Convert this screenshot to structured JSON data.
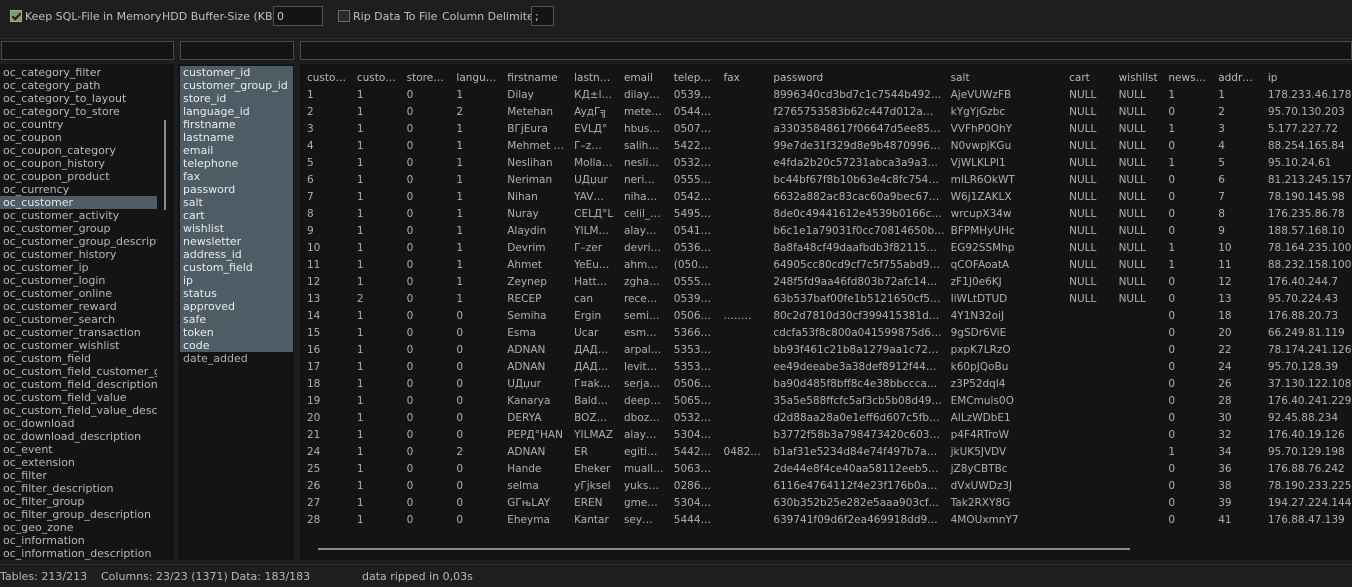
{
  "toolbar": {
    "keep_sql": {
      "label": "Keep SQL-File in Memory",
      "checked": true
    },
    "hdd_buffer": {
      "label": "HDD Buffer-Size (KB):",
      "value": "0"
    },
    "rip_data": {
      "label": "Rip Data To File",
      "checked": false
    },
    "column_delimiter": {
      "label": "Column Delimiter :",
      "value": ";"
    }
  },
  "tables": [
    "oc_category_filter",
    "oc_category_path",
    "oc_category_to_layout",
    "oc_category_to_store",
    "oc_country",
    "oc_coupon",
    "oc_coupon_category",
    "oc_coupon_history",
    "oc_coupon_product",
    "oc_currency",
    "oc_customer",
    "oc_customer_activity",
    "oc_customer_group",
    "oc_customer_group_description",
    "oc_customer_history",
    "oc_customer_ip",
    "oc_customer_login",
    "oc_customer_online",
    "oc_customer_reward",
    "oc_customer_search",
    "oc_customer_transaction",
    "oc_customer_wishlist",
    "oc_custom_field",
    "oc_custom_field_customer_grou",
    "oc_custom_field_description",
    "oc_custom_field_value",
    "oc_custom_field_value_descript",
    "oc_download",
    "oc_download_description",
    "oc_event",
    "oc_extension",
    "oc_filter",
    "oc_filter_description",
    "oc_filter_group",
    "oc_filter_group_description",
    "oc_geo_zone",
    "oc_information",
    "oc_information_description"
  ],
  "selected_table": "oc_customer",
  "columns": [
    {
      "name": "customer_id",
      "selected": true
    },
    {
      "name": "customer_group_id",
      "selected": true
    },
    {
      "name": "store_id",
      "selected": true
    },
    {
      "name": "language_id",
      "selected": true
    },
    {
      "name": "firstname",
      "selected": true
    },
    {
      "name": "lastname",
      "selected": true
    },
    {
      "name": "email",
      "selected": true
    },
    {
      "name": "telephone",
      "selected": true
    },
    {
      "name": "fax",
      "selected": true
    },
    {
      "name": "password",
      "selected": true
    },
    {
      "name": "salt",
      "selected": true
    },
    {
      "name": "cart",
      "selected": true
    },
    {
      "name": "wishlist",
      "selected": true
    },
    {
      "name": "newsletter",
      "selected": true
    },
    {
      "name": "address_id",
      "selected": true
    },
    {
      "name": "custom_field",
      "selected": true
    },
    {
      "name": "ip",
      "selected": true
    },
    {
      "name": "status",
      "selected": true
    },
    {
      "name": "approved",
      "selected": true
    },
    {
      "name": "safe",
      "selected": true
    },
    {
      "name": "token",
      "selected": true
    },
    {
      "name": "code",
      "selected": true
    },
    {
      "name": "date_added",
      "selected": false
    }
  ],
  "grid_headers": [
    "custo…",
    "custo…",
    "store…",
    "langu…",
    "firstname",
    "lastn…",
    "email",
    "telep…",
    "fax",
    "password",
    "salt",
    "cart",
    "wishlist",
    "news…",
    "addr…",
    "ip"
  ],
  "grid_rows": [
    [
      "1",
      "1",
      "0",
      "1",
      "Dilay",
      "КД±l…",
      "dilay…",
      "0539…",
      "",
      "8996340cd3bd7c1c7544b492…",
      "AjeVUWzFB",
      "NULL",
      "NULL",
      "1",
      "1",
      "178.233.46.178"
    ],
    [
      "2",
      "1",
      "0",
      "2",
      "Metehan",
      "AyдГ╗",
      "mete…",
      "0544…",
      "",
      "f2765753583b62c447d012a…",
      "kYgYjGzbc",
      "NULL",
      "NULL",
      "0",
      "2",
      "95.70.130.203"
    ],
    [
      "3",
      "1",
      "0",
      "1",
      "ВГјEura",
      "EVLД°",
      "hbus…",
      "0507…",
      "",
      "a33035848617f06647d5ee85…",
      "VVFhP0OhY",
      "NULL",
      "NULL",
      "1",
      "3",
      "5.177.227.72"
    ],
    [
      "4",
      "1",
      "0",
      "1",
      "Mehmet …",
      "Г–z…",
      "salih…",
      "5422…",
      "",
      "99e7de31f329d8e9b4870996…",
      "N0vwpjKGu",
      "NULL",
      "NULL",
      "0",
      "4",
      "88.254.165.84"
    ],
    [
      "5",
      "1",
      "0",
      "1",
      "Neslihan",
      "Molla…",
      "nesli…",
      "0532…",
      "",
      "e4fda2b20c57231abca3a9a3…",
      "VjWLKLPl1",
      "NULL",
      "NULL",
      "1",
      "5",
      "95.10.24.61"
    ],
    [
      "6",
      "1",
      "0",
      "1",
      "Neriman",
      "UДџur",
      "neri…",
      "0555…",
      "",
      "bc44bf67f8b10b63e4c8fc754…",
      "mlLR6OkWT",
      "NULL",
      "NULL",
      "0",
      "6",
      "81.213.245.157"
    ],
    [
      "7",
      "1",
      "0",
      "1",
      "Nihan",
      "YAV…",
      "niha…",
      "0542…",
      "",
      "6632a882ac83cac60a9bec67…",
      "W6j1ZAKLX",
      "NULL",
      "NULL",
      "0",
      "7",
      "78.190.145.98"
    ],
    [
      "8",
      "1",
      "0",
      "1",
      "Nuray",
      "CELД°L",
      "celil_…",
      "5495…",
      "",
      "8de0c49441612e4539b0166c…",
      "wrcupX34w",
      "NULL",
      "NULL",
      "0",
      "8",
      "176.235.86.78"
    ],
    [
      "9",
      "1",
      "0",
      "1",
      "Alaydin",
      "YILM…",
      "alay…",
      "0541…",
      "",
      "b6c1e1a79031f0cc70814650b…",
      "BFPMHyUHc",
      "NULL",
      "NULL",
      "0",
      "9",
      "188.57.168.10"
    ],
    [
      "10",
      "1",
      "0",
      "1",
      "Devrim",
      "Г–zer",
      "devri…",
      "0536…",
      "",
      "8a8fa48cf49daafbdb3f82115…",
      "EG92SSMhp",
      "NULL",
      "NULL",
      "1",
      "10",
      "78.164.235.100"
    ],
    [
      "11",
      "1",
      "0",
      "1",
      "Ahmet",
      "YeEu…",
      "ahm…",
      "(050…",
      "",
      "64905cc80cd9cf7c5f755abd9…",
      "qCOFAoatA",
      "NULL",
      "NULL",
      "1",
      "11",
      "88.232.158.100"
    ],
    [
      "12",
      "1",
      "0",
      "1",
      "Zeynep",
      "Hatt…",
      "zgha…",
      "0555…",
      "",
      "248f5fd9aa46fd803b72afc14…",
      "zF1J0e6KJ",
      "NULL",
      "NULL",
      "0",
      "12",
      "176.40.244.7"
    ],
    [
      "13",
      "2",
      "0",
      "1",
      "RECEP",
      "can",
      "rece…",
      "0539…",
      "",
      "63b537baf00fe1b5121650cf5…",
      "IiWLtDTUD",
      "NULL",
      "NULL",
      "0",
      "13",
      "95.70.224.43"
    ],
    [
      "14",
      "1",
      "0",
      "0",
      "Semiha",
      "Ergin",
      "semi…",
      "0506…",
      "……..",
      "80c2d7810d30cf399415381d…",
      "4Y1N32oiJ",
      "",
      "",
      "0",
      "0",
      "18",
      "176.88.20.73"
    ],
    [
      "15",
      "1",
      "0",
      "0",
      "Esma",
      "Ucar",
      "esm…",
      "5366…",
      "",
      "cdcfa53f8c800a041599875d6…",
      "9gSDr6ViE",
      "",
      "",
      "0",
      "0",
      "20",
      "66.249.81.119"
    ],
    [
      "16",
      "1",
      "0",
      "0",
      "ADNAN",
      "ДАД…",
      "arpal…",
      "5353…",
      "",
      "bb93f461c21b8a1279aa1c72…",
      "pxpK7LRzO",
      "",
      "",
      "0",
      "0",
      "22",
      "78.174.241.126"
    ],
    [
      "17",
      "1",
      "0",
      "0",
      "ADNAN",
      "ДАД…",
      "levit…",
      "5353…",
      "",
      "ee49deeabe3a38def8912f44…",
      "k60pJQoBu",
      "",
      "",
      "0",
      "0",
      "24",
      "95.70.128.39"
    ],
    [
      "18",
      "1",
      "0",
      "0",
      "UДџur",
      "Г¤ak…",
      "serja…",
      "0506…",
      "",
      "ba90d485f8bff8c4e38bbccca…",
      "z3P52dql4",
      "",
      "",
      "0",
      "0",
      "26",
      "37.130.122.108"
    ],
    [
      "19",
      "1",
      "0",
      "0",
      "Kanarya",
      "Bald…",
      "deep…",
      "5065…",
      "",
      "35a5e588ffcfc5af3cb5b08d49…",
      "EMCmuls0O",
      "",
      "",
      "0",
      "0",
      "28",
      "176.40.241.229"
    ],
    [
      "20",
      "1",
      "0",
      "0",
      "DERYA",
      "BOZ…",
      "dboz…",
      "0532…",
      "",
      "d2d88aa28a0e1eff6d607c5fb…",
      "AILzWDbE1",
      "",
      "",
      "0",
      "0",
      "30",
      "92.45.88.234"
    ],
    [
      "21",
      "1",
      "0",
      "0",
      "РЕРД°HAN",
      "YILMAZ",
      "alay…",
      "5304…",
      "",
      "b3772f58b3a798473420c603…",
      "p4F4RTroW",
      "",
      "",
      "0",
      "0",
      "32",
      "176.40.19.126"
    ],
    [
      "24",
      "1",
      "0",
      "2",
      "ADNAN",
      "ER",
      "egiti…",
      "5442…",
      "0482…",
      "b1af31e5234d84e74f497b7a…",
      "jkUK5JVDV",
      "",
      "",
      "0",
      "1",
      "34",
      "95.70.129.198"
    ],
    [
      "25",
      "1",
      "0",
      "0",
      "Hande",
      "Eheker",
      "muall…",
      "5063…",
      "",
      "2de44e8f4ce40aa58112eeb5…",
      "jZ8yCBTBc",
      "",
      "",
      "0",
      "0",
      "36",
      "176.88.76.242"
    ],
    [
      "26",
      "1",
      "0",
      "0",
      "selma",
      "уГјksel",
      "yuks…",
      "0286…",
      "",
      "6116e4764112f4e23f176b0a…",
      "dVxUWDz3J",
      "",
      "",
      "0",
      "0",
      "38",
      "78.190.233.225"
    ],
    [
      "27",
      "1",
      "0",
      "0",
      "GГњLAY",
      "EREN",
      "gme…",
      "5304…",
      "",
      "630b352b25e282e5aaa903cf…",
      "Tak2RXY8G",
      "",
      "",
      "0",
      "0",
      "39",
      "194.27.224.144"
    ],
    [
      "28",
      "1",
      "0",
      "0",
      "Eheyma",
      "Kantar",
      "sey…",
      "5444…",
      "",
      "639741f09d6f2ea469918dd9…",
      "4MOUxmnY7",
      "",
      "",
      "0",
      "0",
      "41",
      "176.88.47.139"
    ]
  ],
  "status": {
    "tables": "Tables: 213/213",
    "columns": "Columns: 23/23 (1371)",
    "data": "Data: 183/183",
    "message": "data ripped in 0,03s"
  }
}
